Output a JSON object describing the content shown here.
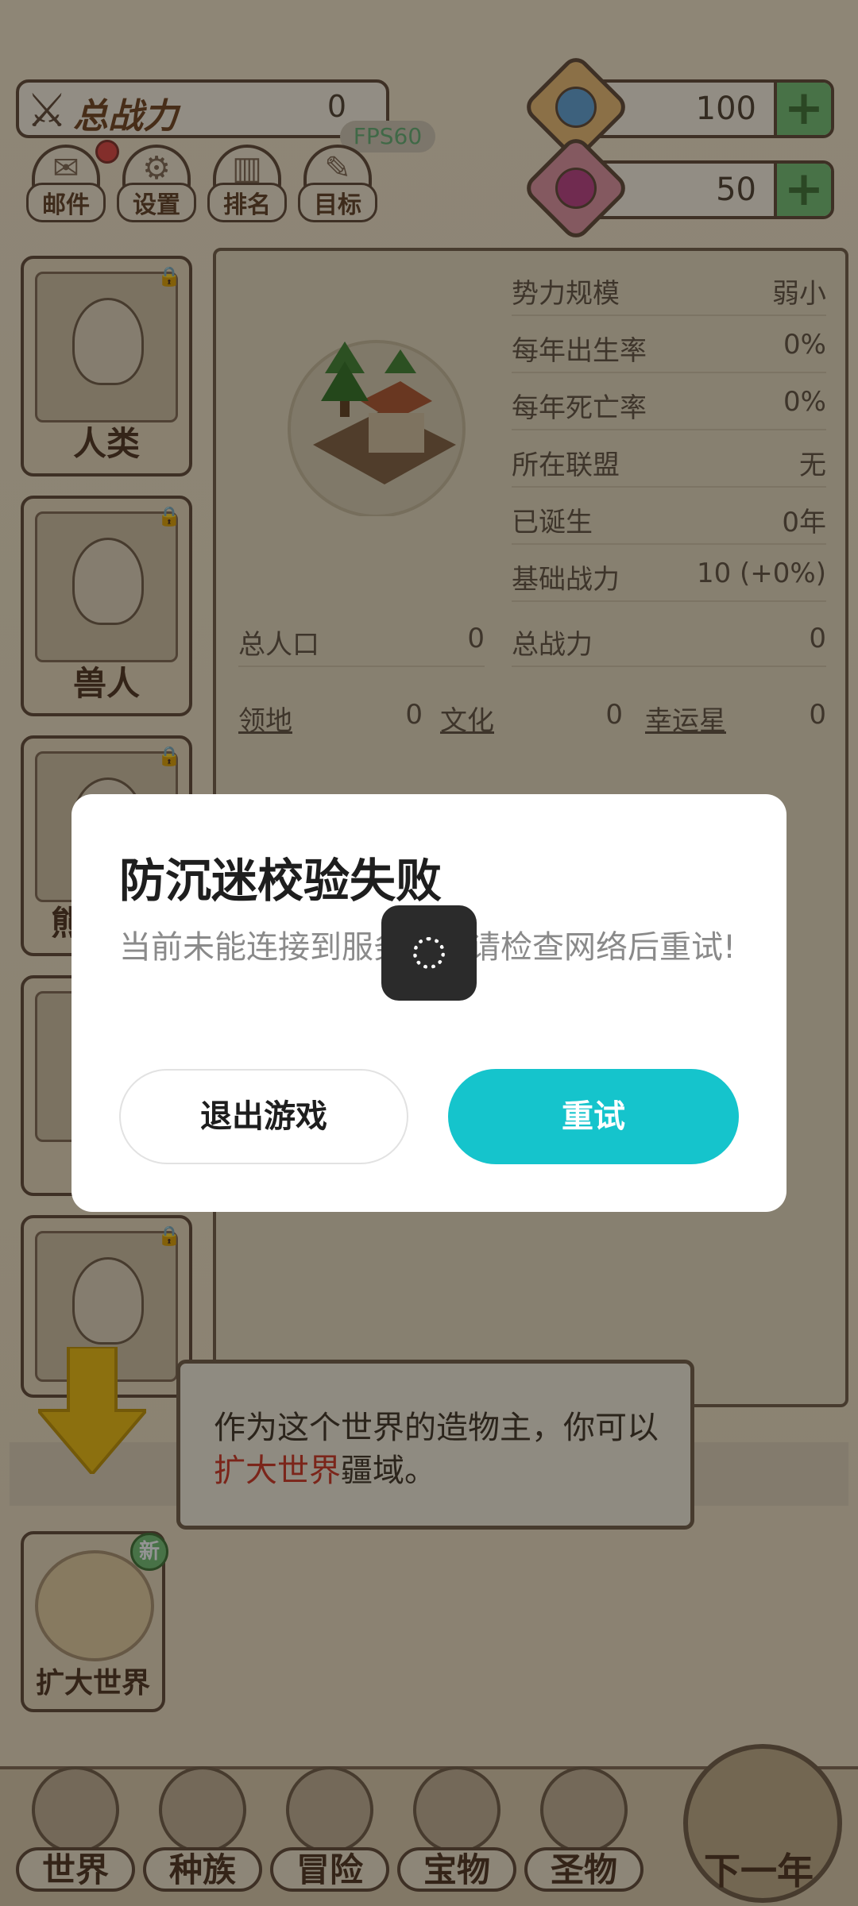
{
  "hud": {
    "power_label": "总战力",
    "power_value": "0",
    "fps": "FPS60",
    "currency1_value": "100",
    "currency2_value": "50",
    "plus": "+"
  },
  "menu": [
    {
      "label": "邮件",
      "icon": "mail-icon"
    },
    {
      "label": "设置",
      "icon": "gear-icon"
    },
    {
      "label": "排名",
      "icon": "ranking-icon"
    },
    {
      "label": "目标",
      "icon": "goal-icon"
    }
  ],
  "races": [
    {
      "label": "人类"
    },
    {
      "label": "兽人"
    },
    {
      "label": "熊"
    },
    {
      "label": ""
    },
    {
      "label": ""
    }
  ],
  "stats": [
    {
      "key": "势力规模",
      "value": "弱小"
    },
    {
      "key": "每年出生率",
      "value": "0%"
    },
    {
      "key": "每年死亡率",
      "value": "0%"
    },
    {
      "key": "所在联盟",
      "value": "无"
    },
    {
      "key": "已诞生",
      "value": "0年"
    },
    {
      "key": "基础战力",
      "value": "10 (+0%)"
    }
  ],
  "population": {
    "key": "总人口",
    "value": "0"
  },
  "total_power": {
    "key": "总战力",
    "value": "0"
  },
  "bottom_stats": [
    {
      "key": "领地",
      "value": "0"
    },
    {
      "key": "文化",
      "value": "0"
    },
    {
      "key": "幸运星",
      "value": "0"
    }
  ],
  "tutorial": {
    "text_before": "作为这个世界的造物主，你可以",
    "highlight": "扩大世界",
    "text_after": "疆域。"
  },
  "expand": {
    "label": "扩大世界",
    "badge": "新"
  },
  "nav": [
    {
      "label": "世界"
    },
    {
      "label": "种族"
    },
    {
      "label": "冒险"
    },
    {
      "label": "宝物"
    },
    {
      "label": "圣物"
    }
  ],
  "next_label": "下一年",
  "dialog": {
    "title": "防沉迷校验失败",
    "message": "当前未能连接到服务器，请检查网络后重试!",
    "exit_label": "退出游戏",
    "retry_label": "重试"
  },
  "colors": {
    "accent": "#15c4cc",
    "highlight": "#d4402e"
  }
}
